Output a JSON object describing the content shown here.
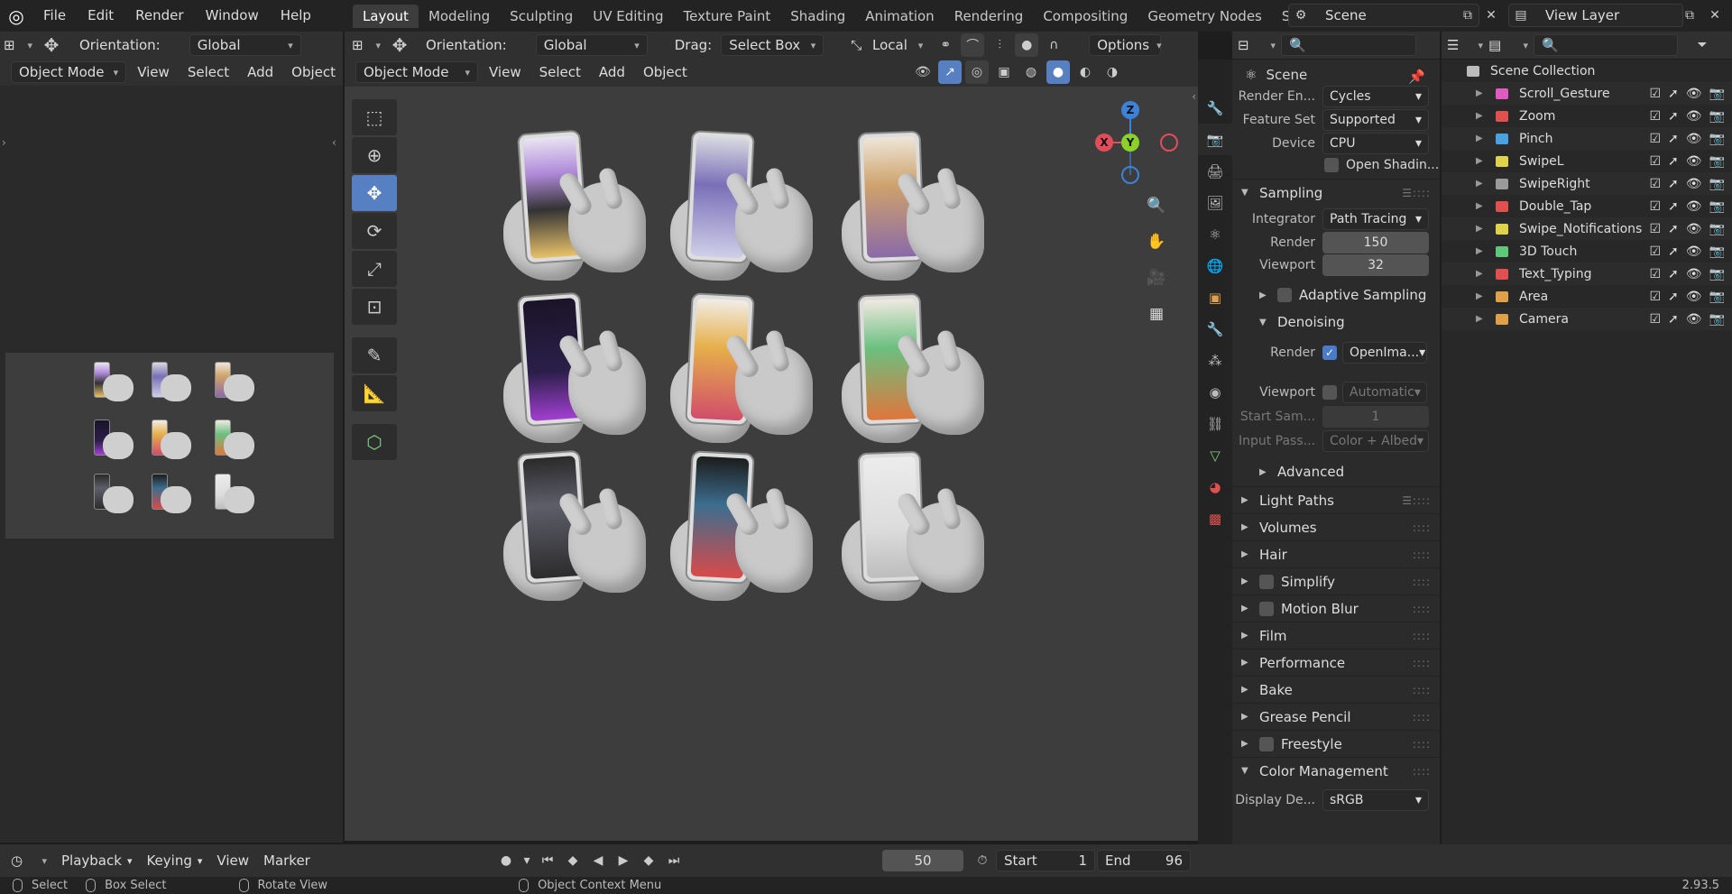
{
  "menu": [
    "File",
    "Edit",
    "Render",
    "Window",
    "Help"
  ],
  "workspaces": [
    {
      "label": "Layout",
      "active": true
    },
    {
      "label": "Modeling"
    },
    {
      "label": "Sculpting"
    },
    {
      "label": "UV Editing"
    },
    {
      "label": "Texture Paint"
    },
    {
      "label": "Shading"
    },
    {
      "label": "Animation"
    },
    {
      "label": "Rendering"
    },
    {
      "label": "Compositing"
    },
    {
      "label": "Geometry Nodes"
    },
    {
      "label": "Scripting"
    }
  ],
  "scene": {
    "name": "Scene",
    "view_layer": "View Layer"
  },
  "left_editor": {
    "orientation_label": "Orientation:",
    "orientation_value": "Global",
    "mode": "Object Mode",
    "menus": [
      "View",
      "Select",
      "Add",
      "Object"
    ]
  },
  "viewport_header": {
    "orientation_label": "Orientation:",
    "orientation_value": "Global",
    "drag_label": "Drag:",
    "drag_value": "Select Box",
    "pivot": "Local",
    "options": "Options",
    "mode": "Object Mode",
    "menus": [
      "View",
      "Select",
      "Add",
      "Object"
    ]
  },
  "gizmo": {
    "x": "X",
    "y": "Y",
    "z": "Z",
    "x_color": "#e14e5a",
    "y_color": "#8bd12a",
    "z_color": "#3c82d8"
  },
  "properties": {
    "title": "Scene",
    "render_engine_label": "Render En...",
    "render_engine": "Cycles",
    "feature_set_label": "Feature Set",
    "feature_set": "Supported",
    "device_label": "Device",
    "device": "CPU",
    "open_shading": "Open Shadin...",
    "sampling": "Sampling",
    "integrator_label": "Integrator",
    "integrator": "Path Tracing",
    "render_label": "Render",
    "render_samples": "150",
    "viewport_label": "Viewport",
    "viewport_samples": "32",
    "adaptive_sampling": "Adaptive Sampling",
    "denoising": "Denoising",
    "den_render_label": "Render",
    "den_render_value": "OpenIma...",
    "den_viewport_label": "Viewport",
    "den_viewport_value": "Automatic",
    "start_sample_label": "Start Sam...",
    "start_sample_value": "1",
    "input_passes_label": "Input Pass...",
    "input_passes_value": "Color + Albed",
    "advanced": "Advanced",
    "panels": [
      "Light Paths",
      "Volumes",
      "Hair",
      "Simplify",
      "Motion Blur",
      "Film",
      "Performance",
      "Bake",
      "Grease Pencil",
      "Freestyle",
      "Color Management"
    ],
    "display_device_label": "Display De...",
    "display_device": "sRGB"
  },
  "outliner": {
    "root": "Scene Collection",
    "items": [
      {
        "name": "Scroll_Gesture",
        "color": "#e05bbf"
      },
      {
        "name": "Zoom",
        "color": "#e0504e"
      },
      {
        "name": "Pinch",
        "color": "#4aa3e0"
      },
      {
        "name": "SwipeL",
        "color": "#e0d24a"
      },
      {
        "name": "SwipeRight",
        "color": "#9a9a9a"
      },
      {
        "name": "Double_Tap",
        "color": "#e0504e"
      },
      {
        "name": "Swipe_Notifications",
        "color": "#e0d24a"
      },
      {
        "name": "3D Touch",
        "color": "#5ec77a"
      },
      {
        "name": "Text_Typing",
        "color": "#e0504e"
      },
      {
        "name": "Area",
        "color": "#e0a04a"
      },
      {
        "name": "Camera",
        "color": "#e0a04a"
      }
    ]
  },
  "timeline": {
    "menus": [
      "Playback",
      "Keying",
      "View",
      "Marker"
    ],
    "current_frame": "50",
    "start_label": "Start",
    "start": "1",
    "end_label": "End",
    "end": "96"
  },
  "status": {
    "select": "Select",
    "box_select": "Box Select",
    "rotate_view": "Rotate View",
    "context_menu": "Object Context Menu",
    "version": "2.93.5"
  }
}
